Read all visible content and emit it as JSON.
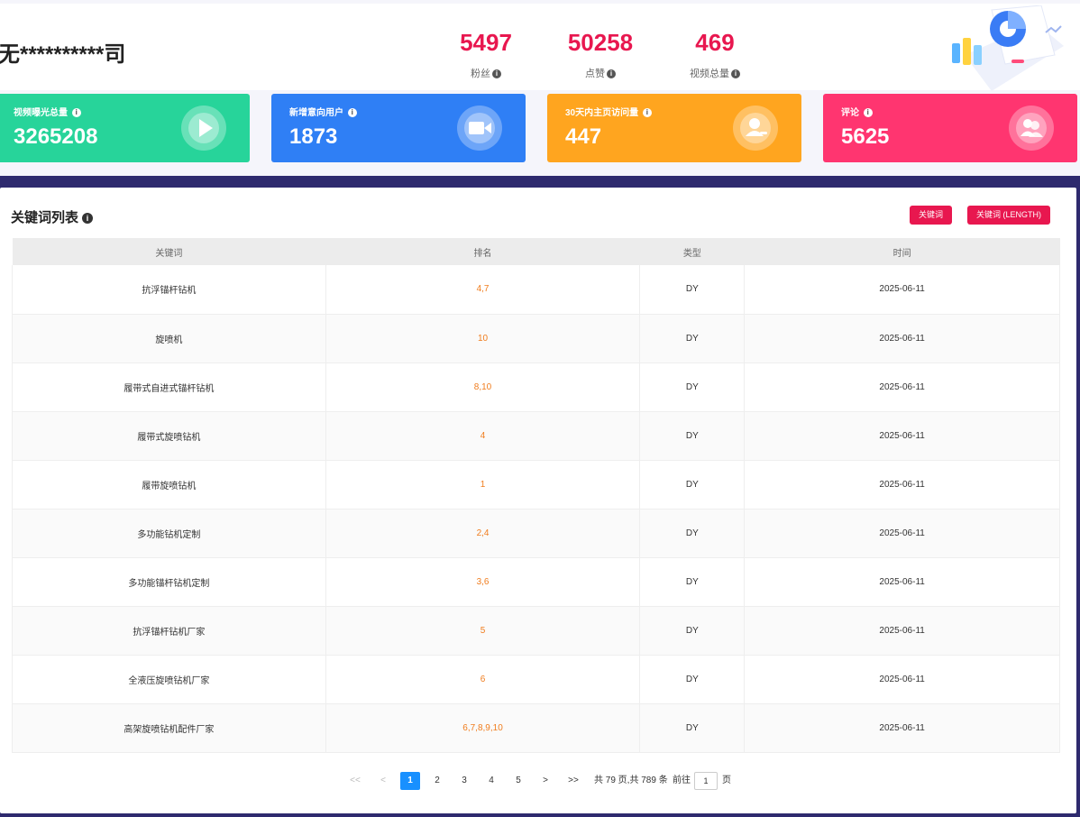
{
  "header": {
    "company": "无**********司",
    "stats": [
      {
        "value": "5497",
        "label": "粉丝"
      },
      {
        "value": "50258",
        "label": "点赞"
      },
      {
        "value": "469",
        "label": "视频总量"
      }
    ]
  },
  "metrics": [
    {
      "label": "视频曝光总量",
      "value": "3265208",
      "icon": "play-icon",
      "color": "#27d49a"
    },
    {
      "label": "新增意向用户",
      "value": "1873",
      "icon": "video-camera-icon",
      "color": "#2f7ff5"
    },
    {
      "label": "30天内主页访问量",
      "value": "447",
      "icon": "user-icon",
      "color": "#ffa51f"
    },
    {
      "label": "评论",
      "value": "5625",
      "icon": "users-icon",
      "color": "#ff3570"
    }
  ],
  "keywords": {
    "title": "关键词列表",
    "buttons": {
      "keyword": "关键词",
      "keyword_length": "关键词 (LENGTH)"
    },
    "columns": [
      "关键词",
      "排名",
      "类型",
      "时间"
    ],
    "rows": [
      {
        "keyword": "抗浮锚杆钻机",
        "rank": "4,7",
        "type": "DY",
        "date": "2025-06-11"
      },
      {
        "keyword": "旋喷机",
        "rank": "10",
        "type": "DY",
        "date": "2025-06-11"
      },
      {
        "keyword": "履带式自进式锚杆钻机",
        "rank": "8,10",
        "type": "DY",
        "date": "2025-06-11"
      },
      {
        "keyword": "履带式旋喷钻机",
        "rank": "4",
        "type": "DY",
        "date": "2025-06-11"
      },
      {
        "keyword": "履带旋喷钻机",
        "rank": "1",
        "type": "DY",
        "date": "2025-06-11"
      },
      {
        "keyword": "多功能钻机定制",
        "rank": "2,4",
        "type": "DY",
        "date": "2025-06-11"
      },
      {
        "keyword": "多功能锚杆钻机定制",
        "rank": "3,6",
        "type": "DY",
        "date": "2025-06-11"
      },
      {
        "keyword": "抗浮锚杆钻机厂家",
        "rank": "5",
        "type": "DY",
        "date": "2025-06-11"
      },
      {
        "keyword": "全液压旋喷钻机厂家",
        "rank": "6",
        "type": "DY",
        "date": "2025-06-11"
      },
      {
        "keyword": "高架旋喷钻机配件厂家",
        "rank": "6,7,8,9,10",
        "type": "DY",
        "date": "2025-06-11"
      }
    ]
  },
  "pagination": {
    "first": "<<",
    "prev": "<",
    "pages": [
      "1",
      "2",
      "3",
      "4",
      "5"
    ],
    "current": "1",
    "next": ">",
    "last": ">>",
    "summary": "共 79 页,共 789 条",
    "goto_label": "前往",
    "goto_value": "1",
    "page_suffix": "页"
  }
}
